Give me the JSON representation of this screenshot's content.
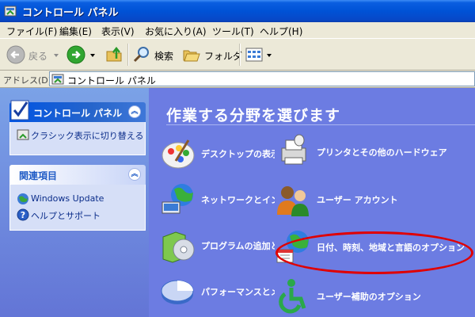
{
  "window": {
    "title": "コントロール パネル"
  },
  "menu": [
    "ファイル(F)",
    "編集(E)",
    "表示(V)",
    "お気に入り(A)",
    "ツール(T)",
    "ヘルプ(H)"
  ],
  "toolbar": {
    "back_label": "戻る",
    "search_label": "検索",
    "folders_label": "フォルダ"
  },
  "address": {
    "label": "アドレス(D)",
    "value": "コントロール パネル"
  },
  "sidebar": {
    "control_panel": {
      "title": "コントロール パネル",
      "links": [
        "クラシック表示に切り替える"
      ]
    },
    "related": {
      "title": "関連項目",
      "links": [
        "Windows Update",
        "ヘルプとサポート"
      ]
    }
  },
  "main": {
    "heading": "作業する分野を選びます",
    "categories": [
      "デスクトップの表示",
      "ネットワークとインターネット",
      "プログラムの追加と削除",
      "パフォーマンスとメンテナンス",
      "プリンタとその他のハードウェア",
      "ユーザー アカウント",
      "日付、時刻、地域と言語のオプション",
      "ユーザー補助のオプション"
    ]
  },
  "colors": {
    "title_bar": "#0052d6",
    "main_bg": "#6c7ce2",
    "annotation": "#e00000"
  }
}
